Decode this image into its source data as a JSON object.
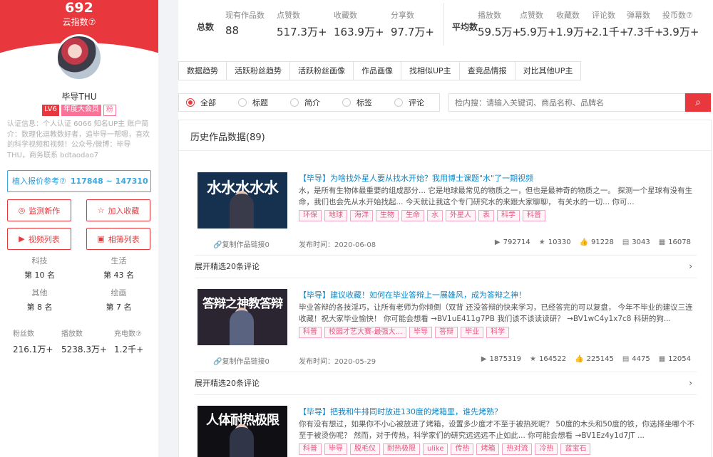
{
  "sidebar": {
    "hero_number": "692",
    "hero_label": "云指数⑦",
    "username": "毕导THU",
    "badges": {
      "level": "LV6",
      "vip": "年度大会员",
      "fan": "粉"
    },
    "description": "认证信息：个人认证 6066 知名UP主\n账户简介：数理化逗教数好者，追毕导一帮嗯，喜欢的科学视频和视频！公众号/微博：毕导THU，商务联系 bdtaodao7",
    "quote_label": "植入报价参考⑦",
    "quote_value": "117848 ~ 147310",
    "buttons": {
      "monitor": "监测新作",
      "favorite": "加入收藏",
      "video_list": "视频列表",
      "album_list": "相簿列表"
    },
    "ranks": [
      {
        "label": "科技",
        "value": "第 10 名"
      },
      {
        "label": "生活",
        "value": "第 43 名"
      },
      {
        "label": "其他",
        "value": "第 8 名"
      },
      {
        "label": "绘画",
        "value": "第 7 名"
      }
    ],
    "stats": [
      {
        "label": "粉丝数",
        "value": "216.1万+"
      },
      {
        "label": "播放数",
        "value": "5238.3万+"
      },
      {
        "label": "充电数⑦",
        "value": "1.2千+"
      }
    ]
  },
  "stats_total": {
    "group": "总数",
    "items": [
      {
        "label": "现有作品数",
        "value": "88"
      },
      {
        "label": "点赞数",
        "value": "517.3万+"
      },
      {
        "label": "收藏数",
        "value": "163.9万+"
      },
      {
        "label": "分享数",
        "value": "97.7万+"
      }
    ]
  },
  "stats_avg": {
    "group": "平均数",
    "items": [
      {
        "label": "播放数",
        "value": "59.5万+"
      },
      {
        "label": "点赞数",
        "value": "5.9万+"
      },
      {
        "label": "收藏数",
        "value": "1.9万+"
      },
      {
        "label": "评论数",
        "value": "2.1千+"
      },
      {
        "label": "弹幕数",
        "value": "7.3千+"
      },
      {
        "label": "投币数⑦",
        "value": "3.9万+"
      }
    ]
  },
  "tabs": [
    "数据趋势",
    "活跃粉丝趋势",
    "活跃粉丝画像",
    "作品画像",
    "找相似UP主",
    "查竞品情报",
    "对比其他UP主"
  ],
  "filter": {
    "options": [
      "全部",
      "标题",
      "简介",
      "标签",
      "评论"
    ],
    "selected": "全部"
  },
  "search": {
    "placeholder": "检内搜：请输入关键词、商品名称、品牌名"
  },
  "panel_title": "历史作品数据(89)",
  "expand_label": "展开精选20条评论",
  "copy_label": "复制作品链接0",
  "videos": [
    {
      "thumb_text": "水水水水水",
      "title": "【毕导】为啥找外星人要从找水开始？我用博士课题\"水\"了一期视频",
      "desc": "水，是所有生物体最重要的组成部分... 它是地球最常见的物质之一，但也是最神奇的物质之一。 探测一个星球有没有生命，我们也会先从水开始找起... 今天就让我这个专门研究水的来跟大家聊聊， 有关水的一切... 你可...",
      "tags": [
        "环保",
        "地球",
        "海洋",
        "生物",
        "生命",
        "水",
        "外星人",
        "表",
        "科学",
        "科普"
      ],
      "published": "发布时间：2020-06-08",
      "metrics": {
        "plays": "792714",
        "coins": "10330",
        "likes": "91228",
        "comments": "3043",
        "favorites": "16078"
      }
    },
    {
      "thumb_text": "答辩之神教答辩",
      "title": "【毕导】建议收藏！如何在毕业答辩上一展雄风，成为答辩之神！",
      "desc": "毕业答辩的各技淫巧，让所有老师为你倾倒（双背 还没答辩的快来学习，已经答完的可以复盘， 今年不毕业的建议三连收藏！祝大家毕业愉快！ 你可能会想看 →BV1uE411g7PB 我们该不该读读研？ →BV1wC4y1x7c8 科研的狗...",
      "tags": [
        "科普",
        "校园才艺大赛-最强大...",
        "毕导",
        "答辩",
        "毕业",
        "科学"
      ],
      "published": "发布时间：2020-05-29",
      "metrics": {
        "plays": "1875319",
        "coins": "164522",
        "likes": "225145",
        "comments": "4475",
        "favorites": "12054"
      }
    },
    {
      "thumb_text": "人体耐热极限",
      "title": "【毕导】把我和牛排同时放进130度的烤箱里，谁先烤熟？",
      "desc": "你有没有想过，如果你不小心被放进了烤箱，设置多少度才不至于被热死呢？ 50度的木头和50度的铁，你选择坐哪个不至于被烫伤呢？ 然而，对于传热，科学家们的研究远远远不止如此... 你可能会想看 →BV1Ez4y1d7JT ...",
      "tags": [
        "科普",
        "毕导",
        "脱毛仪",
        "耐热极限",
        "ulike",
        "传热",
        "烤箱",
        "热对流",
        "冷热",
        "蓝宝石"
      ],
      "published": "",
      "metrics": {
        "plays": "",
        "coins": "",
        "likes": "",
        "comments": "",
        "favorites": ""
      }
    }
  ],
  "colors": {
    "accent": "#e8383d",
    "link": "#0a86c9",
    "tag": "#e8557f"
  }
}
